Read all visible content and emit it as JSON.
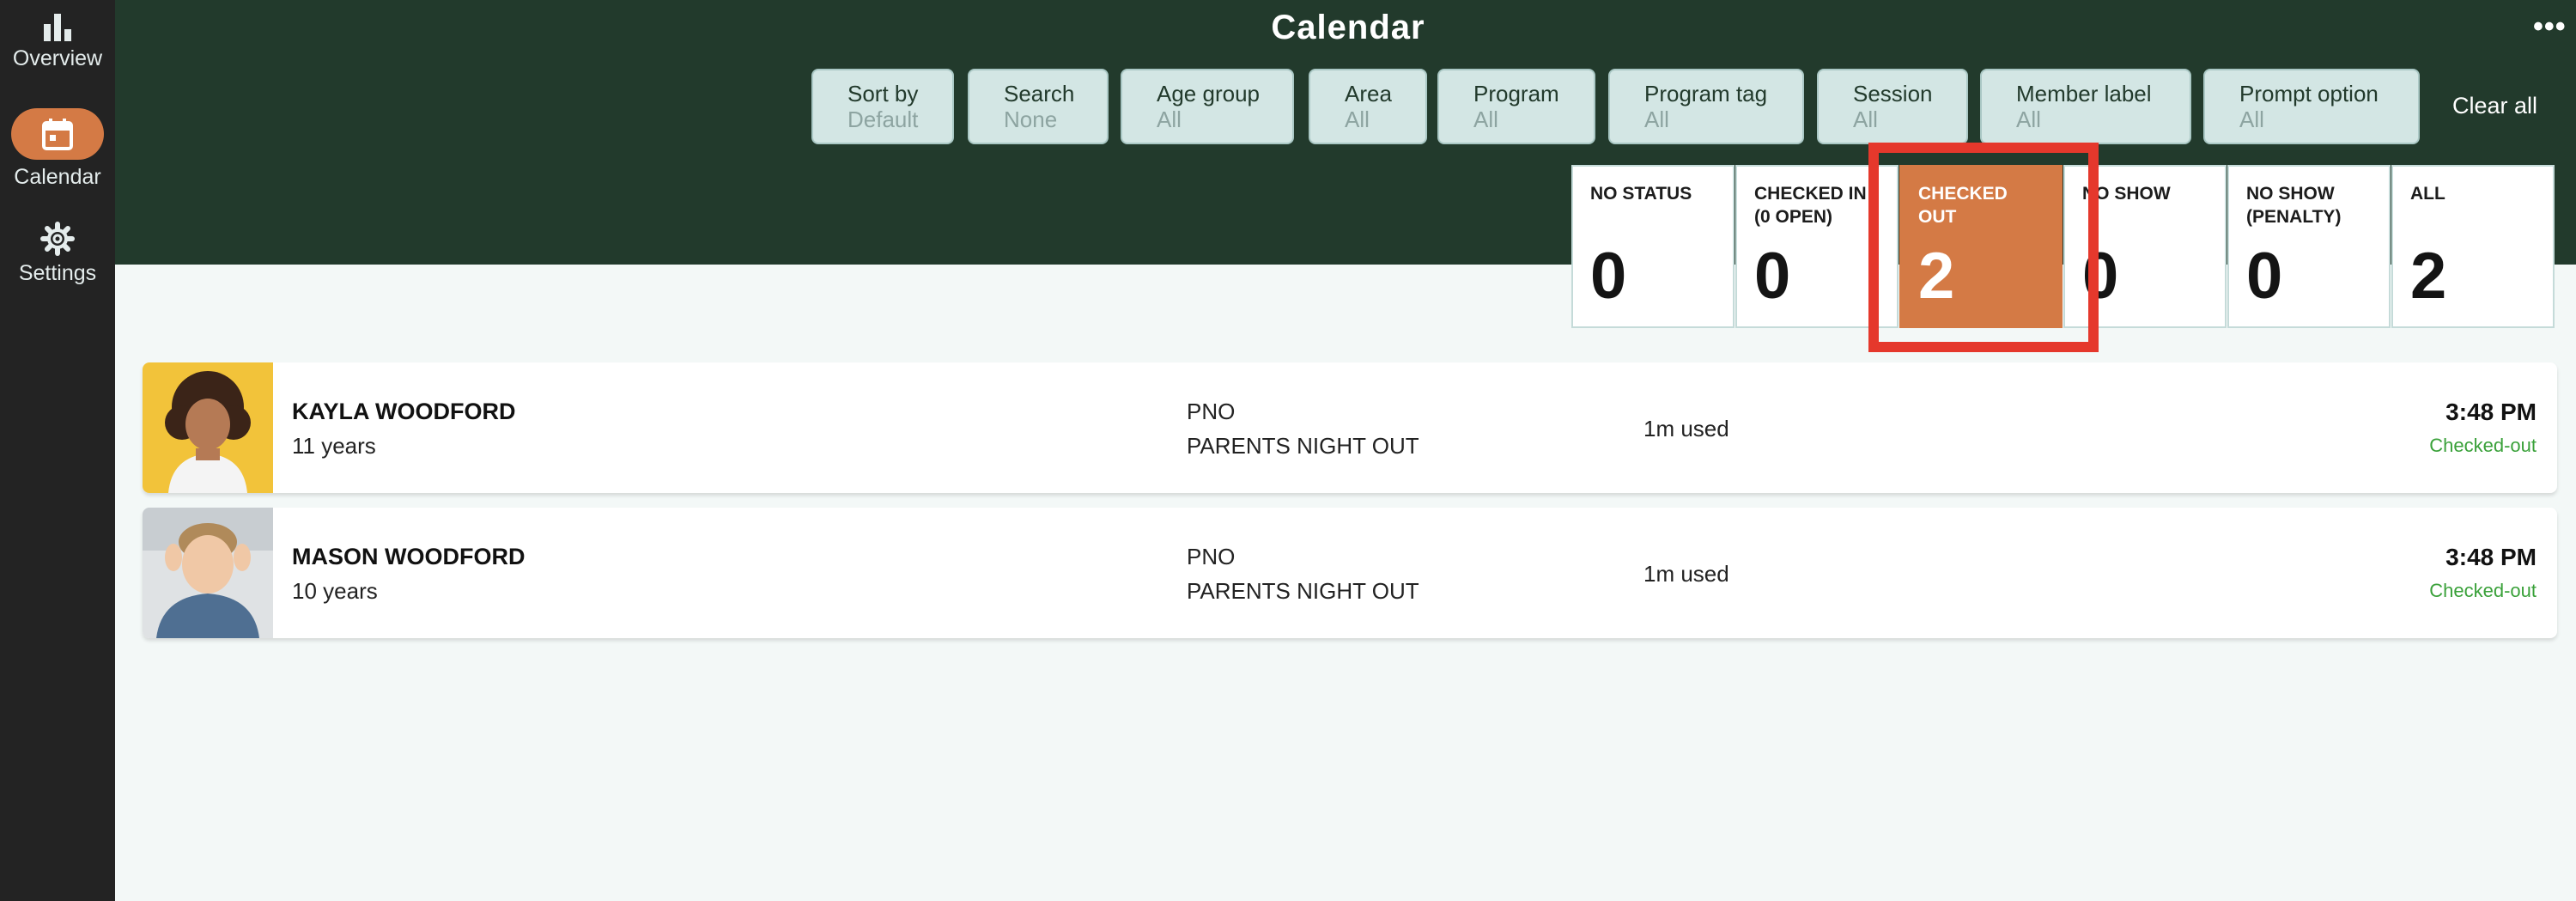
{
  "sidebar": {
    "items": [
      {
        "label": "Overview",
        "icon": "bar-chart-icon"
      },
      {
        "label": "Calendar",
        "icon": "calendar-icon",
        "active": true
      },
      {
        "label": "Settings",
        "icon": "gear-icon"
      }
    ]
  },
  "header": {
    "title": "Calendar",
    "more": "•••",
    "clear_all": "Clear all"
  },
  "filters": [
    {
      "label": "Sort by",
      "value": "Default"
    },
    {
      "label": "Search",
      "value": "None"
    },
    {
      "label": "Age group",
      "value": "All"
    },
    {
      "label": "Area",
      "value": "All"
    },
    {
      "label": "Program",
      "value": "All"
    },
    {
      "label": "Program tag",
      "value": "All"
    },
    {
      "label": "Session",
      "value": "All"
    },
    {
      "label": "Member label",
      "value": "All"
    },
    {
      "label": "Prompt option",
      "value": "All"
    }
  ],
  "status_cards": [
    {
      "label": "NO STATUS",
      "count": "0"
    },
    {
      "label": "CHECKED IN\n(0 OPEN)",
      "count": "0"
    },
    {
      "label": "CHECKED\nOUT",
      "count": "2",
      "active": true
    },
    {
      "label": "NO SHOW",
      "count": "0"
    },
    {
      "label": "NO SHOW\n(PENALTY)",
      "count": "0"
    },
    {
      "label": "ALL",
      "count": "2"
    }
  ],
  "rows": [
    {
      "name": "KAYLA WOODFORD",
      "age": "11 years",
      "program_code": "PNO",
      "program_name": "PARENTS NIGHT OUT",
      "usage": "1m used",
      "time": "3:48 PM",
      "status": "Checked-out"
    },
    {
      "name": "MASON WOODFORD",
      "age": "10 years",
      "program_code": "PNO",
      "program_name": "PARENTS NIGHT OUT",
      "usage": "1m used",
      "time": "3:48 PM",
      "status": "Checked-out"
    }
  ],
  "colors": {
    "header_bg": "#223a2c",
    "accent": "#d47a45",
    "highlight": "#e5382c",
    "status_green": "#3aa13a"
  }
}
